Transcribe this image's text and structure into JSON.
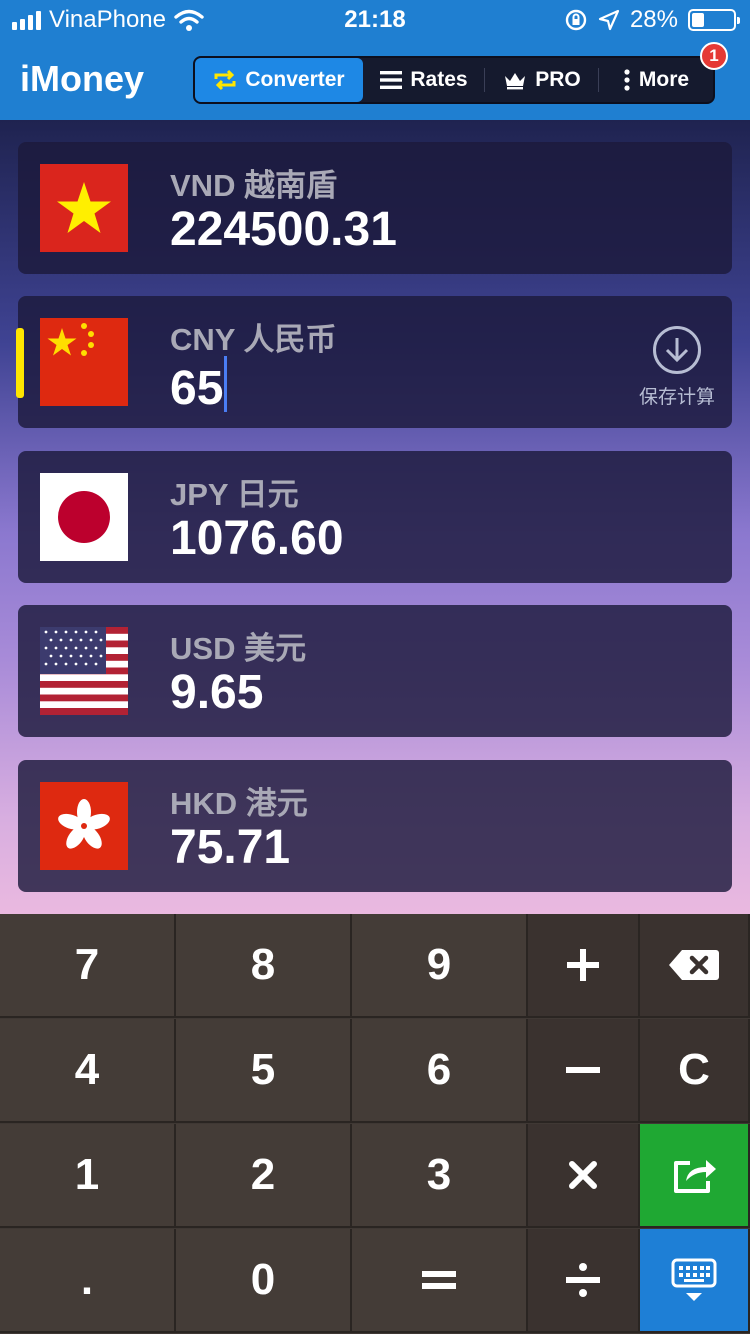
{
  "status_bar": {
    "carrier": "VinaPhone",
    "time": "21:18",
    "battery": "28%",
    "battery_level": 0.28
  },
  "header": {
    "app_title": "iMoney",
    "tabs": [
      {
        "label": "Converter",
        "icon": "repeat-icon",
        "active": true
      },
      {
        "label": "Rates",
        "icon": "list-icon",
        "active": false
      },
      {
        "label": "PRO",
        "icon": "crown-icon",
        "active": false
      },
      {
        "label": "More",
        "icon": "more-vertical-icon",
        "active": false
      }
    ],
    "notification_count": "1"
  },
  "currencies": [
    {
      "code": "VND 越南盾",
      "amount": "224500.31",
      "flag": "vietnam-flag"
    },
    {
      "code": "CNY 人民币",
      "amount": "65",
      "flag": "china-flag",
      "active": true,
      "save_label": "保存计算"
    },
    {
      "code": "JPY 日元",
      "amount": "1076.60",
      "flag": "japan-flag"
    },
    {
      "code": "USD 美元",
      "amount": "9.65",
      "flag": "usa-flag"
    },
    {
      "code": "HKD 港元",
      "amount": "75.71",
      "flag": "hongkong-flag"
    }
  ],
  "keypad": {
    "rows": [
      [
        "7",
        "8",
        "9",
        "+",
        "backspace"
      ],
      [
        "4",
        "5",
        "6",
        "−",
        "C"
      ],
      [
        "1",
        "2",
        "3",
        "×",
        "share"
      ],
      [
        ".",
        "0",
        "=",
        "÷",
        "keyboard-hide"
      ]
    ]
  },
  "colors": {
    "header_blue": "#1f7fd1",
    "active_tab": "#1e88e5",
    "active_marker": "#ffe600",
    "share_key": "#1fa833",
    "keyboard_key": "#1e7fd6"
  }
}
